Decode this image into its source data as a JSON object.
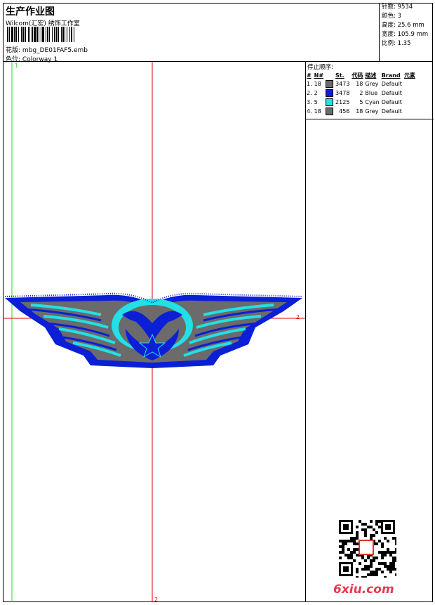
{
  "header": {
    "title": "生产作业图",
    "company": "Wilcom(汇宏) 绣饰工作室",
    "design_label": "花版:",
    "design_file": "mbg_DE01FAF5.emb",
    "colorway_label": "色位:",
    "colorway": "Colorway 1"
  },
  "stats": {
    "stitches": "针数: 9534",
    "colors": "颜色: 3",
    "height": "高度: 25.6 mm",
    "width": "宽度: 105.9 mm",
    "ratio": "比例: 1.35"
  },
  "sequence": {
    "title": "停止顺序:",
    "headers": [
      "#",
      "N#",
      "",
      "St.",
      "代码",
      "描述",
      "Brand",
      "元素"
    ],
    "rows": [
      {
        "idx": "1.",
        "n": "18",
        "color": "#6b6b6b",
        "st": "3473",
        "code": "18",
        "desc": "Grey",
        "brand": "Default"
      },
      {
        "idx": "2.",
        "n": "2",
        "color": "#0a1fd6",
        "st": "3478",
        "code": "2",
        "desc": "Blue",
        "brand": "Default"
      },
      {
        "idx": "3.",
        "n": "5",
        "color": "#22e0e6",
        "st": "2125",
        "code": "5",
        "desc": "Cyan",
        "brand": "Default"
      },
      {
        "idx": "4.",
        "n": "18",
        "color": "#6b6b6b",
        "st": "456",
        "code": "18",
        "desc": "Grey",
        "brand": "Default"
      }
    ]
  },
  "guides": {
    "green_label": "1",
    "red_vertical_label": "2",
    "red_horizontal_label": "2"
  },
  "footer": {
    "site": "6xiu.com"
  },
  "colors": {
    "guide_green": "#33cc33",
    "guide_red": "#e00000",
    "blue": "#0a1fd6",
    "cyan": "#22e0e6",
    "grey": "#6b6b6b"
  }
}
